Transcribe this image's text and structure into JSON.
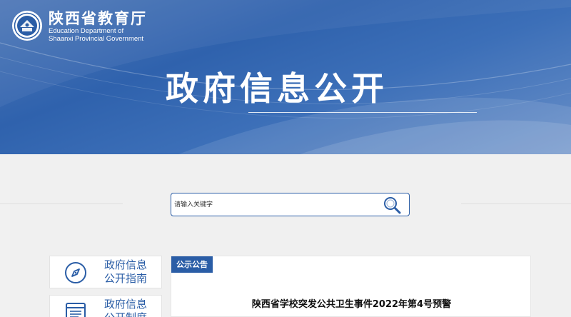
{
  "header": {
    "org_name_cn": "陕西省教育厅",
    "org_name_en_line1": "Education Department of",
    "org_name_en_line2": "Shaanxi Provincial Government",
    "logo_icon": "edu-emblem-icon"
  },
  "banner": {
    "title": "政府信息公开"
  },
  "search": {
    "placeholder": "请输入关键字",
    "value": "",
    "button_icon": "search-icon"
  },
  "sidebar": {
    "items": [
      {
        "label_line1": "政府信息",
        "label_line2": "公开指南",
        "icon": "compass-icon"
      },
      {
        "label_line1": "政府信息",
        "label_line2": "公开制度",
        "icon": "document-list-icon"
      }
    ]
  },
  "panel": {
    "tab": "公示公告",
    "article_title": "陕西省学校突发公共卫生事件2022年第4号预警"
  },
  "colors": {
    "accent": "#2a5da6",
    "banner_blue": "#3465ae",
    "page_bg": "#f0f0f0"
  }
}
